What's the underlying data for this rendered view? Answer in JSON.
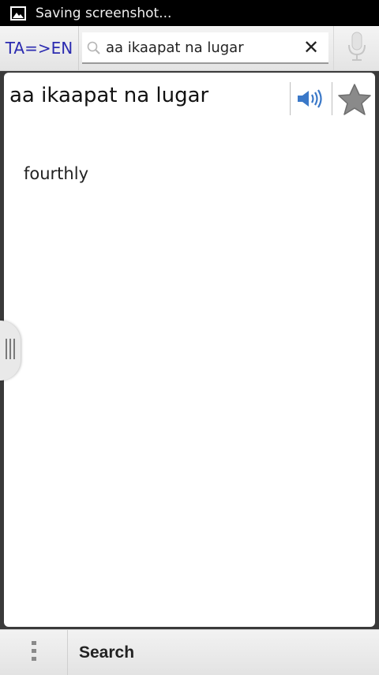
{
  "status_bar": {
    "text": "Saving screenshot...",
    "icon": "image-icon"
  },
  "toolbar": {
    "lang_toggle_label": "TA=>EN",
    "search_value": "aa ikaapat na lugar",
    "search_icon": "search-icon",
    "clear_icon": "close-icon",
    "clear_glyph": "✕",
    "mic_icon": "microphone-icon"
  },
  "entry": {
    "term": "aa ikaapat na lugar",
    "translation": "fourthly",
    "speaker_icon": "speaker-icon",
    "favorite_icon": "star-icon"
  },
  "drawer": {
    "icon": "drawer-handle-icon"
  },
  "bottom_bar": {
    "menu_icon": "overflow-menu-icon",
    "search_label": "Search"
  },
  "colors": {
    "status_bar": "#000000",
    "lang_toggle_text": "#2b2bb0",
    "speaker_blue": "#3a78c8",
    "star_gray": "#8a8a8a"
  }
}
